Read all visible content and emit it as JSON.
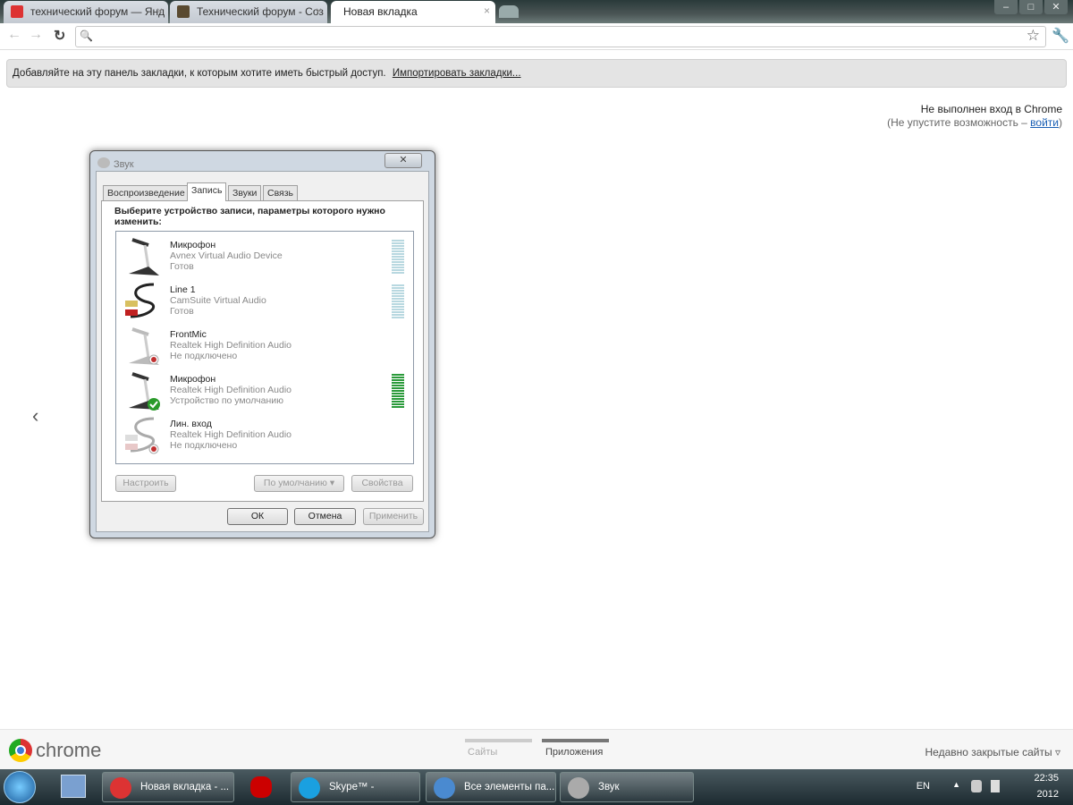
{
  "browser": {
    "tabs": [
      {
        "label": "технический форум — Янд",
        "favicon_color": "#d33"
      },
      {
        "label": "Технический форум - Соз",
        "favicon_color": "#5a4a30"
      },
      {
        "label": "Новая вкладка",
        "active": true
      }
    ],
    "tab_close": "×",
    "window_buttons": [
      "–",
      "□",
      "✕"
    ],
    "nav": {
      "back": "←",
      "forward": "→",
      "reload": "↻",
      "search_icon": "🔍",
      "star": "☆",
      "wrench": "🔧"
    },
    "omnibox_value": "",
    "bookmarks_bar": {
      "text": "Добавляйте на эту панель закладки, к которым хотите иметь быстрый доступ.",
      "link": "Импортировать закладки..."
    },
    "signin": {
      "line1": "Не выполнен вход в Chrome",
      "line2_prefix": "(Не упустите возможность – ",
      "link": "войти",
      "line2_suffix": ")"
    },
    "left_arrow": "‹",
    "footer": {
      "logo": "chrome",
      "pages": [
        "Сайты",
        "Приложения"
      ],
      "active_page": "Приложения",
      "recent": "Недавно закрытые сайты ▿"
    }
  },
  "dialog": {
    "title": "Звук",
    "close": "✕",
    "tabs": [
      "Воспроизведение",
      "Запись",
      "Звуки",
      "Связь"
    ],
    "active_tab": "Запись",
    "header": "Выберите устройство записи, параметры которого нужно изменить:",
    "devices": [
      {
        "name": "Микрофон",
        "device": "Avnex Virtual Audio Device",
        "status": "Готов",
        "type": "mic",
        "meter": "idle"
      },
      {
        "name": "Line 1",
        "device": "CamSuite Virtual Audio",
        "status": "Готов",
        "type": "line",
        "meter": "idle"
      },
      {
        "name": "FrontMic",
        "device": "Realtek High Definition Audio",
        "status": "Не подключено",
        "type": "mic-off",
        "meter": "none"
      },
      {
        "name": "Микрофон",
        "device": "Realtek High Definition Audio",
        "status": "Устройство по умолчанию",
        "type": "mic-default",
        "meter": "active"
      },
      {
        "name": "Лин. вход",
        "device": "Realtek High Definition Audio",
        "status": "Не подключено",
        "type": "line-off",
        "meter": "none"
      }
    ],
    "buttons": {
      "configure": "Настроить",
      "default": "По умолчанию",
      "properties": "Свойства",
      "ok": "ОК",
      "cancel": "Отмена",
      "apply": "Применить"
    }
  },
  "taskbar": {
    "items": [
      {
        "label": "Новая вкладка - ...",
        "icon_color": "#d33"
      },
      {
        "label": "",
        "icon_color": "#c00"
      },
      {
        "label": "Skype™ - ",
        "icon_color": "#1aa0e0"
      },
      {
        "label": "Все элементы па...",
        "icon_color": "#4a8ad0"
      },
      {
        "label": "Звук",
        "icon_color": "#aaa"
      }
    ],
    "lang": "EN",
    "time": "22:35",
    "date": "2012"
  }
}
